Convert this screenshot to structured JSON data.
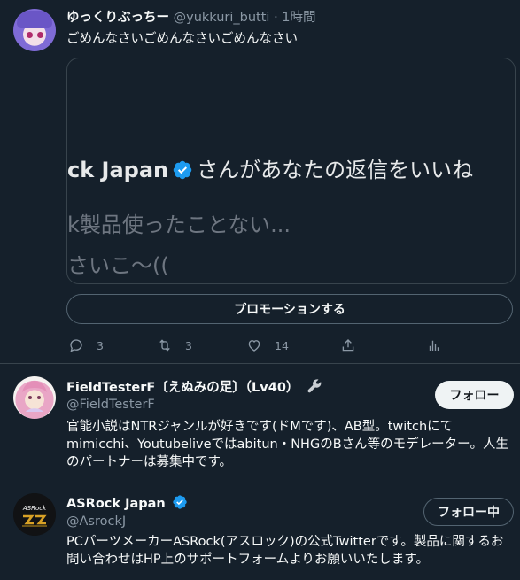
{
  "tweet": {
    "author_name": "ゆっくりぶっちー",
    "author_handle": "@yukkuri_butti",
    "separator": "·",
    "time": "1時間",
    "text": "ごめんなさいごめんなさいごめんなさい",
    "media": {
      "line1_name": "ck Japan",
      "line1_rest": "さんがあなたの返信をいいね",
      "line2": "k製品使ったことない...",
      "line3": "さいこ～(("
    },
    "promote_label": "プロモーションする",
    "actions": {
      "reply_count": "3",
      "retweet_count": "3",
      "like_count": "14"
    }
  },
  "users": [
    {
      "name": "FieldTesterF〔えぬみの足〕（Lv40）",
      "badge_icon": "wrench-icon",
      "handle": "@FieldTesterF",
      "bio": "官能小説はNTRジャンルが好きです(ドMです)、AB型。twitchにて mimicchi、Youtubeliveではabitun・NHGのBさん等のモデレーター。人生のパートナーは募集中です。",
      "button_label": "フォロー"
    },
    {
      "name": "ASRock Japan",
      "handle": "@AsrockJ",
      "bio": "PCパーツメーカーASRock(アスロック)の公式Twitterです。製品に関するお問い合わせはHP上のサポートフォームよりお願いいたします。",
      "button_label": "フォロー中",
      "logo_text": "ASRock"
    }
  ],
  "colors": {
    "background": "#15202b",
    "text": "#f7f9f9",
    "secondary": "#8b98a5",
    "verified": "#1d9bf0",
    "border": "#38444d"
  }
}
